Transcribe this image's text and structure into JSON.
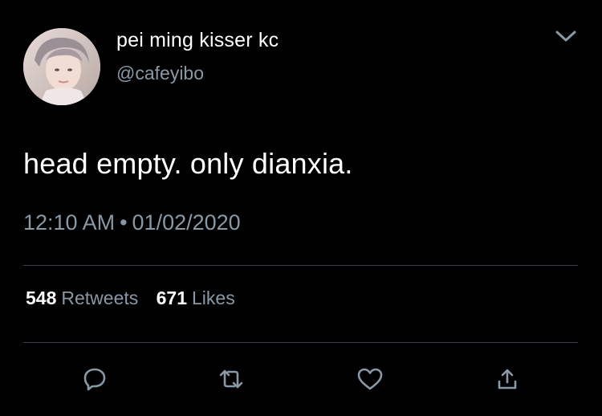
{
  "tweet": {
    "author": {
      "display_name": "pei ming kisser kc",
      "handle": "@cafeyibo",
      "avatar_icon": "profile-photo"
    },
    "text": "head empty. only dianxia.",
    "time": "12:10 AM",
    "separator": "•",
    "date": "01/02/2020",
    "stats": {
      "retweets_count": "548",
      "retweets_label": "Retweets",
      "likes_count": "671",
      "likes_label": "Likes"
    },
    "actions": [
      "reply-icon",
      "retweet-icon",
      "like-icon",
      "share-icon"
    ],
    "menu_icon": "chevron-down-icon"
  },
  "colors": {
    "background": "#000000",
    "primary_text": "#ffffff",
    "secondary_text": "#8899a6",
    "divider": "#38444d",
    "icon": "#8899a6"
  }
}
